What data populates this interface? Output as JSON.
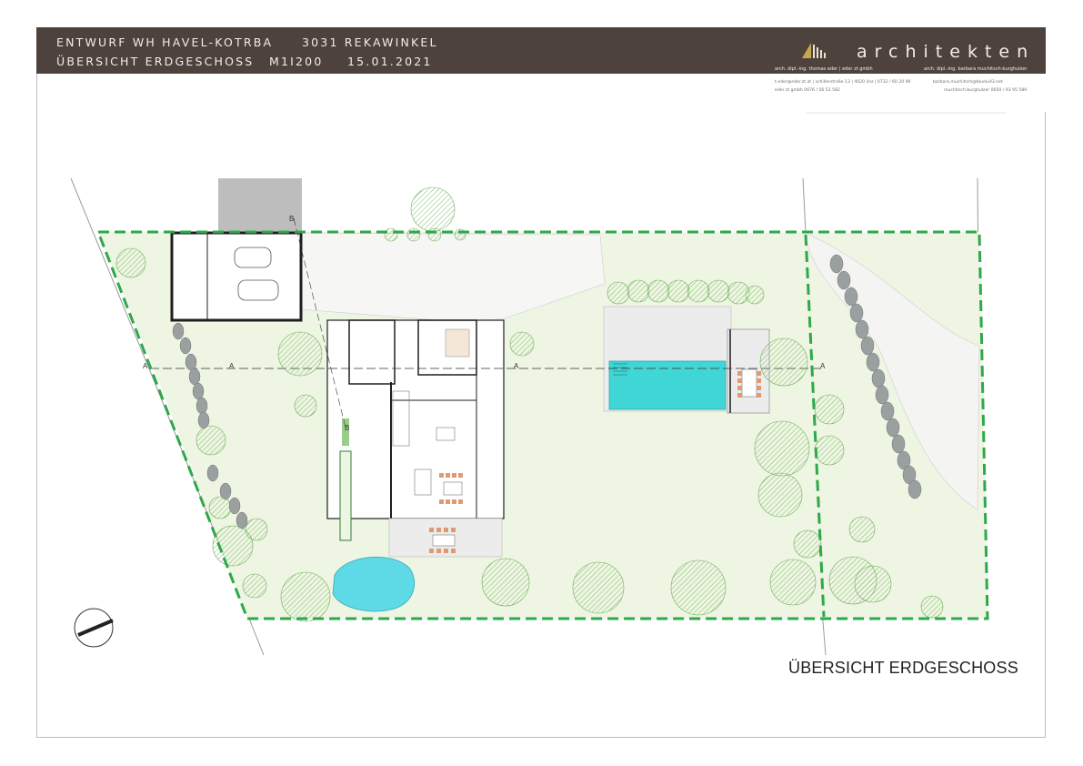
{
  "header": {
    "line1_project": "ENTWURF  WH HAVEL-KOTRBA",
    "line1_location": "3031 REKAWINKEL",
    "line2_title": "ÜBERSICHT ERDGESCHOSS",
    "line2_scale": "M1I200",
    "line2_date": "15.01.2021"
  },
  "firm": {
    "name": "architekten",
    "tag_left": "arch. dipl.-ing. thomas eder | eder zt gmbh",
    "tag_right": "arch. dipl.-ing. barbara muchitsch-burghulzer",
    "contact_left_1": "t.eder@eder.zt.at  |  schillerstraße 13  |  4020 linz  |  0732 / 60 20 90",
    "contact_left_2": "eder zt gmbh   0676 / 56 53 582",
    "contact_right_1": "barbara.muchitsch@bluelu43.net",
    "contact_right_2": "muchitsch-burghulzer   0650 / 93 95 589"
  },
  "plan": {
    "title": "ÜBERSICHT ERDGESCHOSS",
    "section_labels": [
      "A",
      "A",
      "A",
      "A",
      "B",
      "B"
    ],
    "colors": {
      "header_bg": "#4e423d",
      "boundary": "#2ea84a",
      "lawn": "#eef5e2",
      "pool": "#40d6d6",
      "pond": "#5ed9e6",
      "tree": "#8dc97b",
      "stone": "#9aa0a0",
      "furniture": "#e09a73",
      "building_wall": "#1f1f1f"
    }
  }
}
